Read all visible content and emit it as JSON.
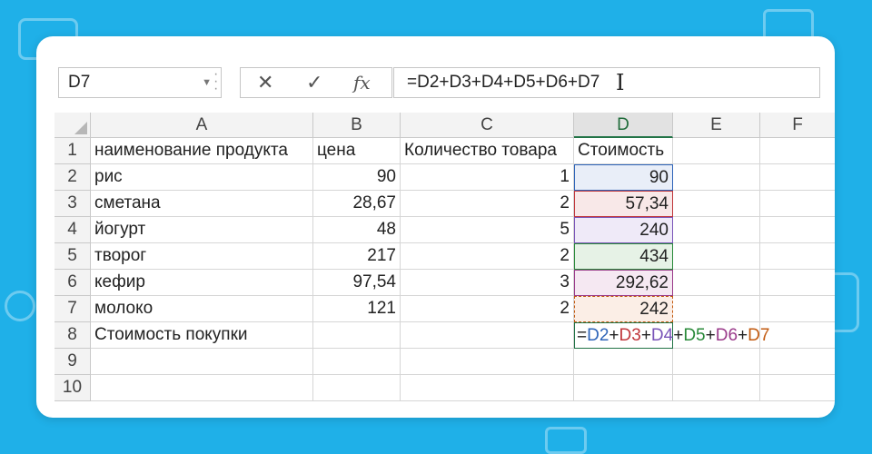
{
  "formula_bar": {
    "name_box": "D7",
    "cancel_icon": "✕",
    "enter_icon": "✓",
    "fx_icon": "fx",
    "formula": "=D2+D3+D4+D5+D6+D7"
  },
  "columns": [
    "A",
    "B",
    "C",
    "D",
    "E",
    "F"
  ],
  "active_column": "D",
  "rows": [
    {
      "n": "1",
      "a": "наименование продукта",
      "b": "цена",
      "c": "Количество товара",
      "d": "Стоимость"
    },
    {
      "n": "2",
      "a": "рис",
      "b": "90",
      "c": "1",
      "d": "90"
    },
    {
      "n": "3",
      "a": "сметана",
      "b": "28,67",
      "c": "2",
      "d": "57,34"
    },
    {
      "n": "4",
      "a": "йогурт",
      "b": "48",
      "c": "5",
      "d": "240"
    },
    {
      "n": "5",
      "a": "творог",
      "b": "217",
      "c": "2",
      "d": "434"
    },
    {
      "n": "6",
      "a": "кефир",
      "b": "97,54",
      "c": "3",
      "d": "292,62"
    },
    {
      "n": "7",
      "a": "молоко",
      "b": "121",
      "c": "2",
      "d": "242"
    },
    {
      "n": "8",
      "a": "Стоимость покупки",
      "b": "",
      "c": "",
      "d": ""
    },
    {
      "n": "9",
      "a": "",
      "b": "",
      "c": "",
      "d": ""
    },
    {
      "n": "10",
      "a": "",
      "b": "",
      "c": "",
      "d": ""
    }
  ],
  "edit_formula": {
    "eq": "=",
    "refs": [
      {
        "ref": "D2",
        "color": "#2e64b8"
      },
      {
        "ref": "D3",
        "color": "#c0363b"
      },
      {
        "ref": "D4",
        "color": "#7a55b8"
      },
      {
        "ref": "D5",
        "color": "#2a8a3a"
      },
      {
        "ref": "D6",
        "color": "#9a3a8a"
      },
      {
        "ref": "D7",
        "color": "#c25a10"
      }
    ],
    "plus": "+"
  },
  "highlight_colors": {
    "D2": {
      "border": "#2e64b8",
      "fill": "#e9eef8"
    },
    "D3": {
      "border": "#c0363b",
      "fill": "#f8e8e8"
    },
    "D4": {
      "border": "#7a55b8",
      "fill": "#efeaf8"
    },
    "D5": {
      "border": "#2a8a3a",
      "fill": "#e6f2e6"
    },
    "D6": {
      "border": "#9a3a8a",
      "fill": "#f5e8f2"
    },
    "D7": {
      "border": "#c25a10",
      "fill": "#fbeee6"
    }
  }
}
